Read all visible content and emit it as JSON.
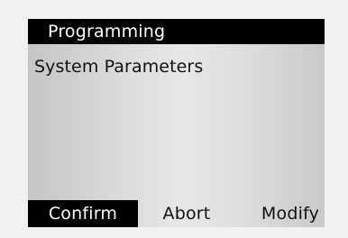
{
  "header": {
    "title": "Programming"
  },
  "main": {
    "line": "System Parameters"
  },
  "softkeys": {
    "confirm": "Confirm",
    "abort": "Abort",
    "modify": "Modify",
    "selected": "confirm"
  }
}
